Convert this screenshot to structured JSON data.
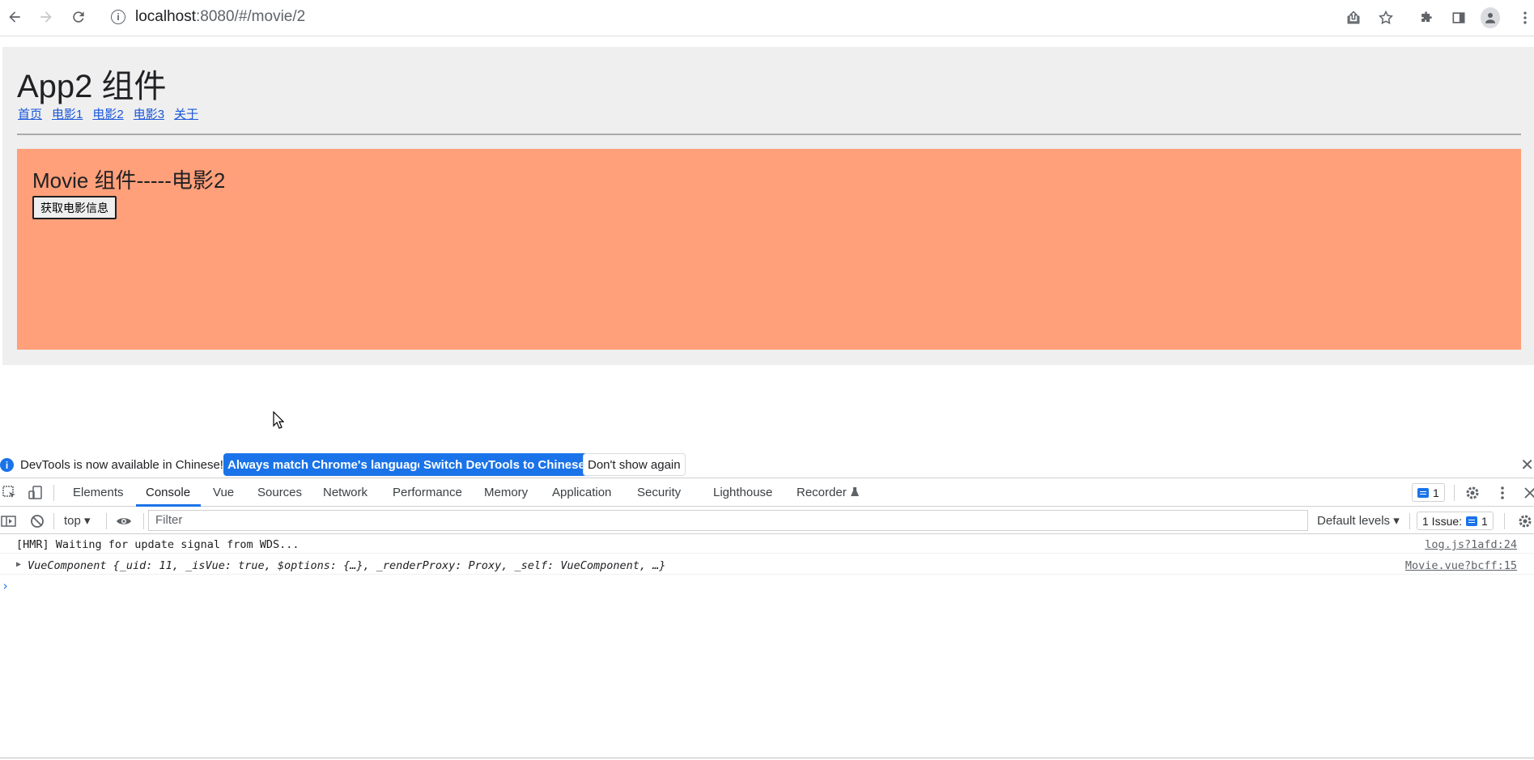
{
  "browser": {
    "url_host": "localhost",
    "url_path": ":8080/#/movie/2"
  },
  "app": {
    "title": "App2 组件",
    "nav": [
      "首页",
      "电影1",
      "电影2",
      "电影3",
      "关于"
    ],
    "movie_title": "Movie 组件-----电影2",
    "movie_button": "获取电影信息",
    "movie_bg": "#ffa07a"
  },
  "devtools": {
    "info_text": "DevTools is now available in Chinese!",
    "btn_match": "Always match Chrome's language",
    "btn_switch": "Switch DevTools to Chinese",
    "btn_dismiss": "Don't show again",
    "tabs": [
      "Elements",
      "Console",
      "Vue",
      "Sources",
      "Network",
      "Performance",
      "Memory",
      "Application",
      "Security",
      "Lighthouse",
      "Recorder"
    ],
    "active_tab": "Console",
    "issues_count": "1",
    "context": "top",
    "filter_placeholder": "Filter",
    "levels": "Default levels",
    "issues_label": "1 Issue:",
    "issues_badge": "1",
    "logs": [
      {
        "text": "[HMR] Waiting for update signal from WDS...",
        "source": "log.js?1afd:24"
      },
      {
        "text": "VueComponent {_uid: 11, _isVue: true, $options: {…}, _renderProxy: Proxy, _self: VueComponent, …}",
        "source": "Movie.vue?bcff:15"
      }
    ],
    "accent": "#1a73e8"
  }
}
